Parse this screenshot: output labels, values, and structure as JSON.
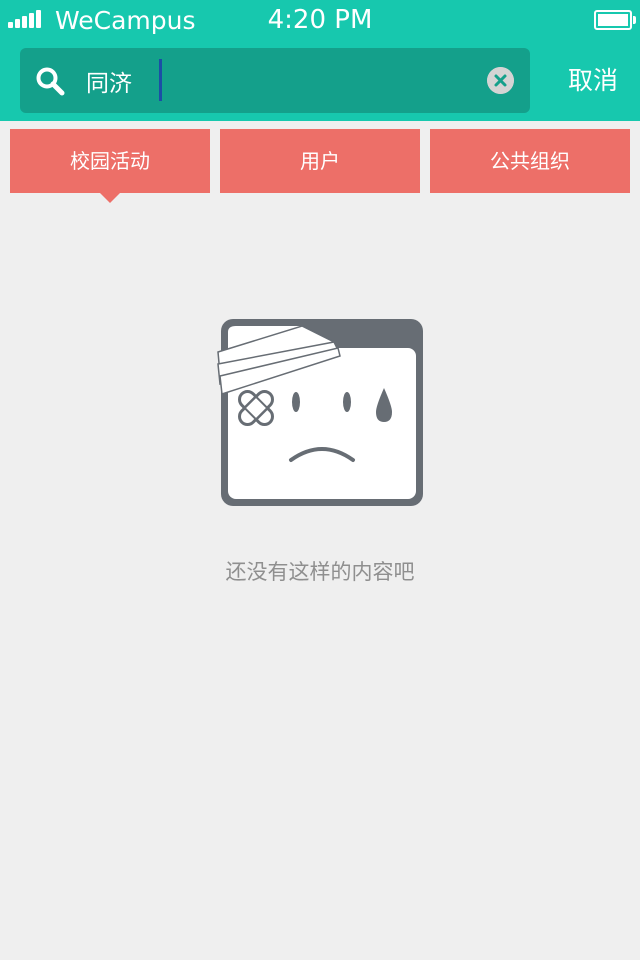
{
  "status_bar": {
    "carrier": "WeCampus",
    "time": "4:20 PM",
    "icons": [
      "signal-icon",
      "battery-icon"
    ]
  },
  "search": {
    "value": "同济",
    "cancel_label": "取消",
    "icons": [
      "search-icon",
      "clear-icon"
    ]
  },
  "tabs": [
    {
      "label": "校园活动",
      "selected": true
    },
    {
      "label": "用户",
      "selected": false
    },
    {
      "label": "公共组织",
      "selected": false
    }
  ],
  "empty_state": {
    "message": "还没有这样的内容吧",
    "icon": "sad-bandaged-face-icon"
  },
  "colors": {
    "header": "#17c8ae",
    "search_box": "#14a08b",
    "tab": "#ed6f68",
    "background": "#efefef",
    "message_text": "#8f8f8f",
    "illustration": "#676d74"
  }
}
